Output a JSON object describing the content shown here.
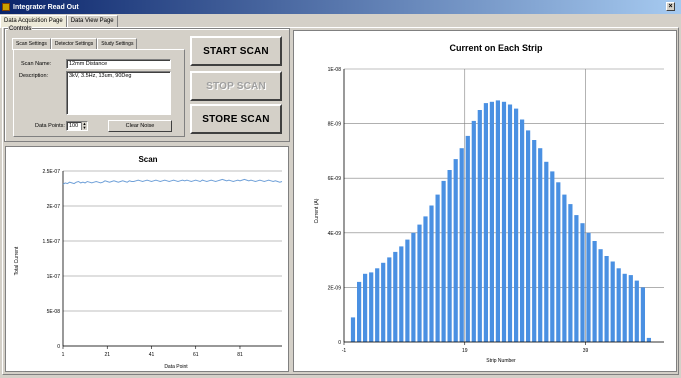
{
  "window": {
    "title": "Integrator Read Out",
    "close_label": "×"
  },
  "tabs": [
    {
      "label": "Data Acquisition Page",
      "active": true
    },
    {
      "label": "Data View Page",
      "active": false
    }
  ],
  "controls": {
    "legend": "Controls",
    "subtabs": [
      {
        "label": "Scan Settings",
        "active": true
      },
      {
        "label": "Detector Settings",
        "active": false
      },
      {
        "label": "Study Settings",
        "active": false
      }
    ],
    "scan_name_label": "Scan Name:",
    "scan_name_value": "12mm Distance",
    "description_label": "Description:",
    "description_value": "3kV, 3.5Hz, 13um, 90Deg",
    "data_points_label": "Data Points:",
    "data_points_value": "100",
    "clear_noise_label": "Clear Noise",
    "start_scan_label": "START SCAN",
    "stop_scan_label": "STOP SCAN",
    "store_scan_label": "STORE SCAN"
  },
  "chart_data": [
    {
      "type": "line",
      "title": "Scan",
      "xlabel": "Data Point",
      "ylabel": "Total Current",
      "xlim": [
        1,
        100
      ],
      "ylim": [
        0,
        2.5e-07
      ],
      "xticks": [
        "1",
        "21",
        "41",
        "61",
        "81"
      ],
      "xtick_values": [
        1,
        21,
        41,
        61,
        81
      ],
      "yticks": [
        "0",
        "5E-08",
        "1E-07",
        "1.5E-07",
        "2E-07",
        "2.5E-07"
      ],
      "ytick_values": [
        0,
        5e-08,
        1e-07,
        1.5e-07,
        2e-07,
        2.5e-07
      ],
      "grid": "horizontal",
      "color": "#6fa0d8",
      "series": [
        {
          "values": [
            2.31e-07,
            2.33e-07,
            2.32e-07,
            2.34e-07,
            2.33e-07,
            2.32e-07,
            2.34e-07,
            2.35e-07,
            2.33e-07,
            2.34e-07,
            2.33e-07,
            2.35e-07,
            2.34e-07,
            2.33e-07,
            2.34e-07,
            2.35e-07,
            2.34e-07,
            2.33e-07,
            2.34e-07,
            2.36e-07,
            2.35e-07,
            2.34e-07,
            2.35e-07,
            2.36e-07,
            2.35e-07,
            2.34e-07,
            2.35e-07,
            2.36e-07,
            2.35e-07,
            2.34e-07,
            2.36e-07,
            2.35e-07,
            2.35e-07,
            2.36e-07,
            2.37e-07,
            2.36e-07,
            2.35e-07,
            2.36e-07,
            2.37e-07,
            2.36e-07,
            2.35e-07,
            2.36e-07,
            2.37e-07,
            2.36e-07,
            2.35e-07,
            2.36e-07,
            2.37e-07,
            2.36e-07,
            2.35e-07,
            2.36e-07,
            2.37e-07,
            2.36e-07,
            2.35e-07,
            2.36e-07,
            2.37e-07,
            2.36e-07,
            2.37e-07,
            2.36e-07,
            2.35e-07,
            2.36e-07,
            2.37e-07,
            2.36e-07,
            2.35e-07,
            2.37e-07,
            2.36e-07,
            2.35e-07,
            2.36e-07,
            2.37e-07,
            2.36e-07,
            2.35e-07,
            2.36e-07,
            2.37e-07,
            2.38e-07,
            2.37e-07,
            2.36e-07,
            2.37e-07,
            2.36e-07,
            2.35e-07,
            2.36e-07,
            2.37e-07,
            2.36e-07,
            2.37e-07,
            2.38e-07,
            2.37e-07,
            2.36e-07,
            2.37e-07,
            2.36e-07,
            2.35e-07,
            2.36e-07,
            2.37e-07,
            2.36e-07,
            2.35e-07,
            2.36e-07,
            2.37e-07,
            2.36e-07,
            2.35e-07,
            2.36e-07,
            2.35e-07,
            2.34e-07,
            2.35e-07
          ]
        }
      ]
    },
    {
      "type": "bar",
      "title": "Current on Each Strip",
      "xlabel": "Strip Number",
      "ylabel": "Current (A)",
      "xlim": [
        -1,
        52
      ],
      "ylim": [
        0,
        1e-08
      ],
      "xticks": [
        "-1",
        "19",
        "39"
      ],
      "xtick_values": [
        -1,
        19,
        39
      ],
      "yticks": [
        "0",
        "2E-09",
        "4E-09",
        "6E-09",
        "8E-09",
        "1E-08"
      ],
      "ytick_values": [
        0,
        2e-09,
        4e-09,
        6e-09,
        8e-09,
        1e-08
      ],
      "grid": "both",
      "color": "#4a90e2",
      "x": [
        0,
        1,
        2,
        3,
        4,
        5,
        6,
        7,
        8,
        9,
        10,
        11,
        12,
        13,
        14,
        15,
        16,
        17,
        18,
        19,
        20,
        21,
        22,
        23,
        24,
        25,
        26,
        27,
        28,
        29,
        30,
        31,
        32,
        33,
        34,
        35,
        36,
        37,
        38,
        39,
        40,
        41,
        42,
        43,
        44,
        45,
        46,
        47,
        48,
        49
      ],
      "values": [
        9e-10,
        2.2e-09,
        2.5e-09,
        2.55e-09,
        2.7e-09,
        2.9e-09,
        3.1e-09,
        3.3e-09,
        3.5e-09,
        3.75e-09,
        4e-09,
        4.3e-09,
        4.6e-09,
        5e-09,
        5.4e-09,
        5.9e-09,
        6.3e-09,
        6.7e-09,
        7.1e-09,
        7.55e-09,
        8.1e-09,
        8.5e-09,
        8.75e-09,
        8.8e-09,
        8.85e-09,
        8.8e-09,
        8.7e-09,
        8.55e-09,
        8.15e-09,
        7.75e-09,
        7.4e-09,
        7.1e-09,
        6.6e-09,
        6.25e-09,
        5.85e-09,
        5.4e-09,
        5.05e-09,
        4.65e-09,
        4.35e-09,
        4e-09,
        3.7e-09,
        3.4e-09,
        3.15e-09,
        2.95e-09,
        2.7e-09,
        2.5e-09,
        2.45e-09,
        2.25e-09,
        2e-09,
        1.5e-10
      ]
    }
  ]
}
